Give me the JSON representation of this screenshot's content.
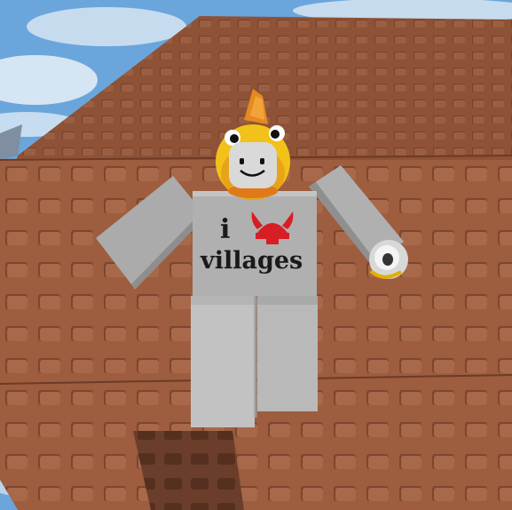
{
  "scene": {
    "shirt": {
      "line1": "i",
      "line2": "villages",
      "logo_icon": "viking-helmet-icon"
    },
    "colors": {
      "sky": "#6aa6dc",
      "brick": "#9a5a3c",
      "avatar_gray": "#a9a9a9",
      "helmet": "#d61f25",
      "hat_yellow": "#f2c21a"
    }
  }
}
